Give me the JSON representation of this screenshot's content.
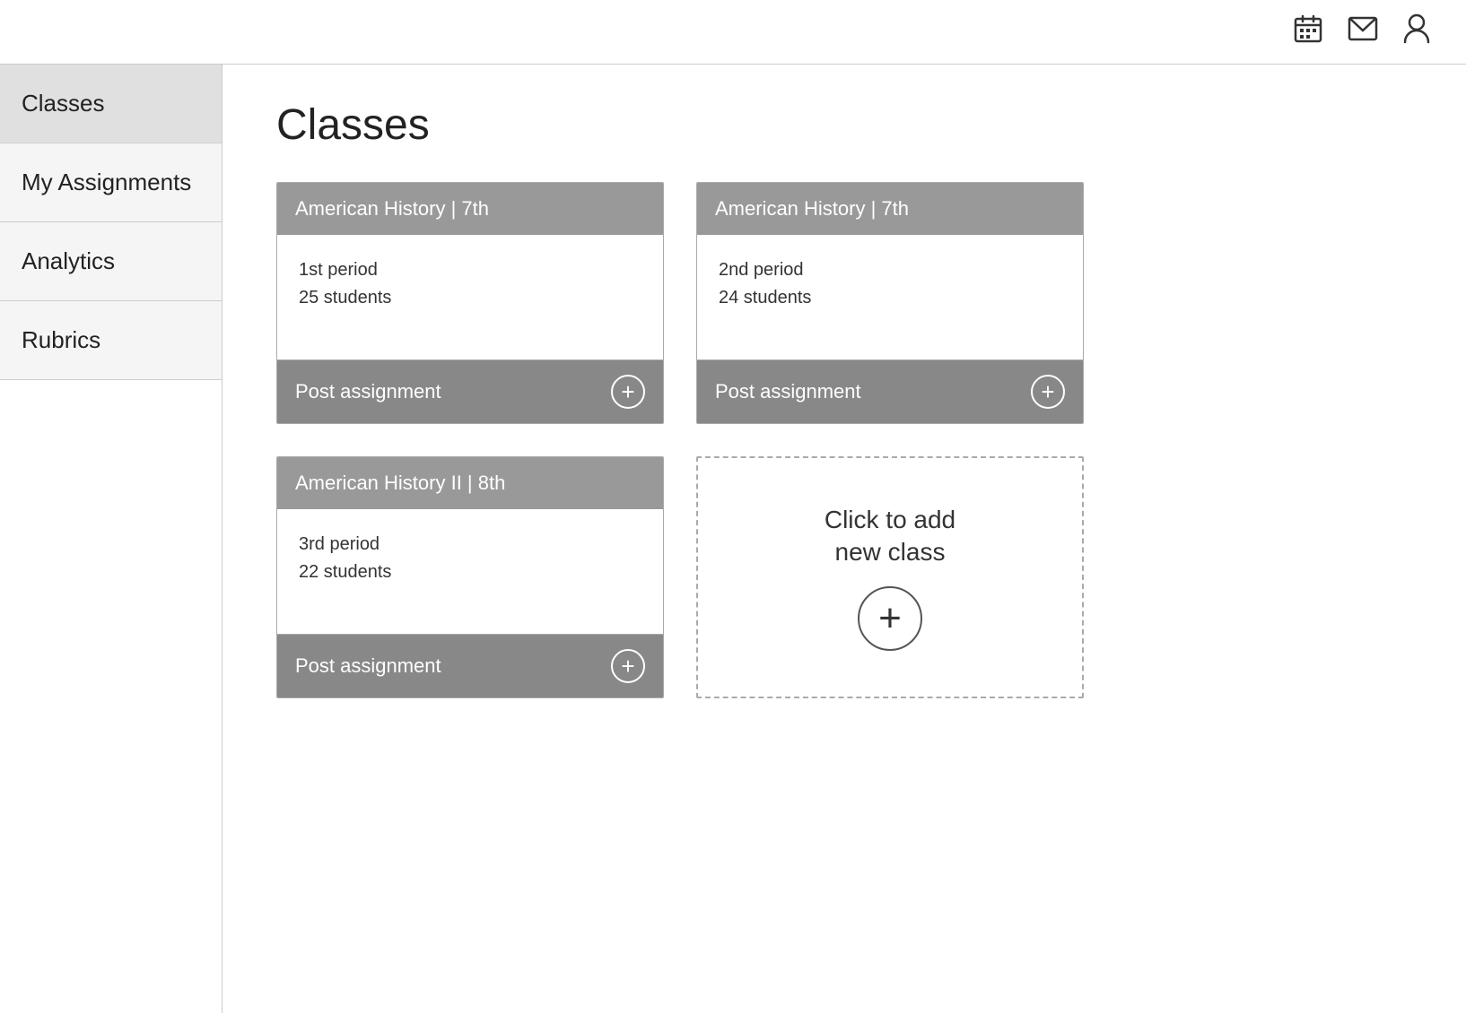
{
  "header": {
    "calendar_icon": "📅",
    "mail_icon": "✉",
    "user_icon": "👤"
  },
  "sidebar": {
    "items": [
      {
        "label": "Classes",
        "id": "classes",
        "active": true
      },
      {
        "label": "My Assignments",
        "id": "my-assignments"
      },
      {
        "label": "Analytics",
        "id": "analytics"
      },
      {
        "label": "Rubrics",
        "id": "rubrics"
      }
    ]
  },
  "page": {
    "title": "Classes"
  },
  "classes": [
    {
      "name": "American History | 7th",
      "period": "1st period",
      "students": "25 students",
      "post_label": "Post assignment"
    },
    {
      "name": "American History | 7th",
      "period": "2nd period",
      "students": "24 students",
      "post_label": "Post assignment"
    },
    {
      "name": "American History II | 8th",
      "period": "3rd period",
      "students": "22 students",
      "post_label": "Post assignment"
    }
  ],
  "add_class": {
    "text": "Click to add\nnew class",
    "plus": "+"
  }
}
